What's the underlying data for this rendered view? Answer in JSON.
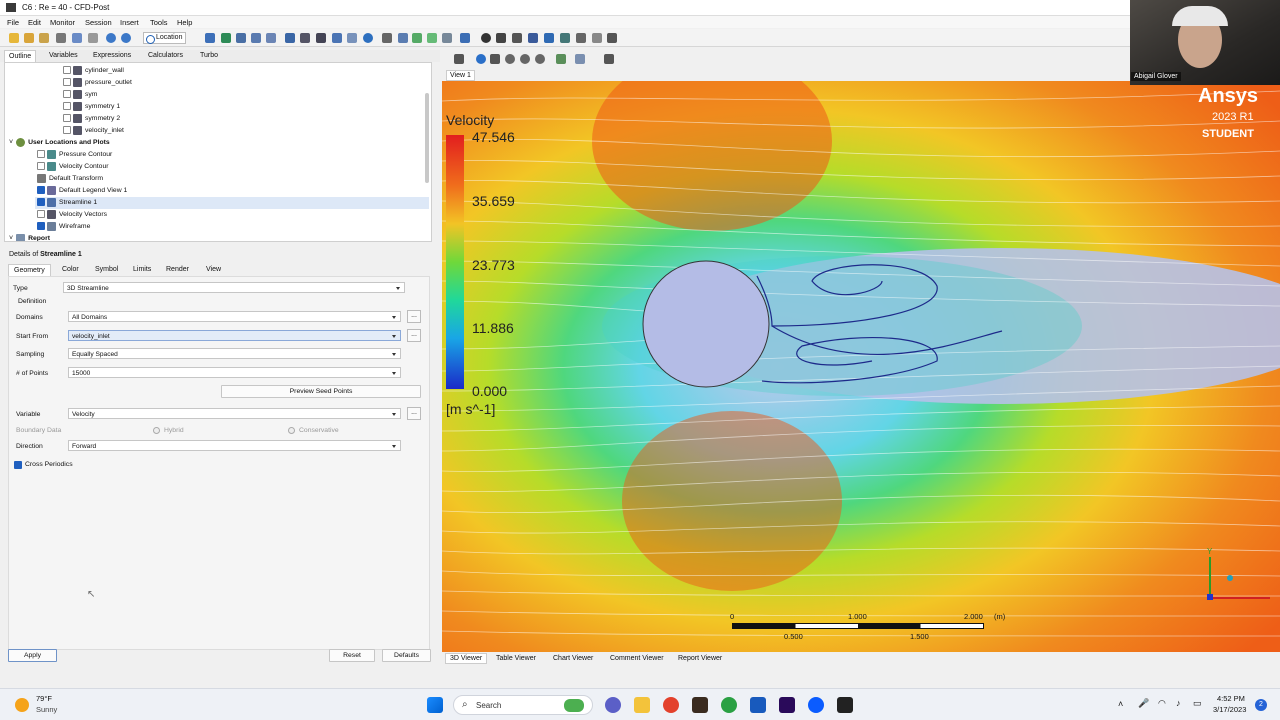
{
  "window": {
    "title": "C6 : Re = 40 - CFD-Post"
  },
  "menu": [
    "File",
    "Edit",
    "Monitor",
    "Session",
    "Insert",
    "Tools",
    "Help"
  ],
  "toolbar": {
    "location_label": "Location"
  },
  "left_tabs": [
    "Outline",
    "Variables",
    "Expressions",
    "Calculators",
    "Turbo"
  ],
  "tree": {
    "items": [
      {
        "label": "cylinder_wall",
        "checked": false
      },
      {
        "label": "pressure_outlet",
        "checked": false
      },
      {
        "label": "sym",
        "checked": false
      },
      {
        "label": "symmetry 1",
        "checked": false
      },
      {
        "label": "symmetry 2",
        "checked": false
      },
      {
        "label": "velocity_inlet",
        "checked": false
      }
    ],
    "group": "User Locations and Plots",
    "user_items": [
      {
        "label": "Pressure Contour",
        "checked": false
      },
      {
        "label": "Velocity Contour",
        "checked": false
      },
      {
        "label": "Default Transform",
        "checked": null
      },
      {
        "label": "Default Legend View 1",
        "checked": true
      },
      {
        "label": "Streamline 1",
        "checked": true
      },
      {
        "label": "Velocity Vectors",
        "checked": false
      },
      {
        "label": "Wireframe",
        "checked": true
      }
    ],
    "report": "Report"
  },
  "details": {
    "title_prefix": "Details of",
    "title_name": "Streamline 1",
    "tabs": [
      "Geometry",
      "Color",
      "Symbol",
      "Limits",
      "Render",
      "View"
    ],
    "type_label": "Type",
    "type_value": "3D Streamline",
    "definition_label": "Definition",
    "domains_label": "Domains",
    "domains_value": "All Domains",
    "start_from_label": "Start From",
    "start_from_value": "velocity_inlet",
    "sampling_label": "Sampling",
    "sampling_value": "Equally Spaced",
    "points_label": "# of Points",
    "points_value": "15000",
    "preview_button": "Preview Seed Points",
    "variable_label": "Variable",
    "variable_value": "Velocity",
    "boundary_label": "Boundary Data",
    "hybrid_label": "Hybrid",
    "conservative_label": "Conservative",
    "direction_label": "Direction",
    "direction_value": "Forward",
    "cross_periodics_label": "Cross Periodics",
    "ellipsis": "...",
    "apply_button": "Apply",
    "reset_button": "Reset",
    "defaults_button": "Defaults"
  },
  "viewer": {
    "view_label": "View 1",
    "legend_title": "Velocity",
    "legend_values": [
      "47.546",
      "35.659",
      "23.773",
      "11.886",
      "0.000"
    ],
    "legend_unit": "[m s^-1]",
    "ansys_logo": "Ansys",
    "ansys_version": "2023 R1",
    "ansys_edition": "STUDENT",
    "scale_labels": [
      "0",
      "1.000",
      "2.000",
      "(m)"
    ],
    "scale_sublabels": [
      "0.500",
      "1.500"
    ],
    "axis_y": "Y",
    "bottom_tabs": [
      "3D Viewer",
      "Table Viewer",
      "Chart Viewer",
      "Comment Viewer",
      "Report Viewer"
    ]
  },
  "webcam": {
    "name": "Abigail Glover"
  },
  "taskbar": {
    "weather_temp": "79°F",
    "weather_desc": "Sunny",
    "search_placeholder": "Search",
    "time": "4:52 PM",
    "date": "3/17/2023",
    "notification_count": "2"
  },
  "colors": {
    "jet_high": "#e0301e",
    "jet_low": "#1030c0",
    "selection": "#dde8f7"
  }
}
